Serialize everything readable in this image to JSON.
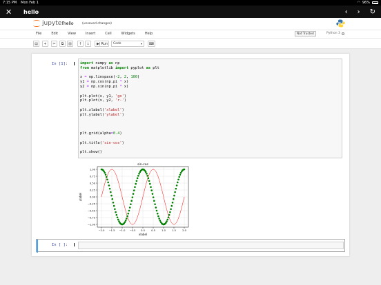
{
  "status_bar": {
    "time": "7:15 PM",
    "date": "Mon Feb 1",
    "battery": "96%"
  },
  "nav": {
    "title": "hello",
    "close_icon": "close-icon",
    "back_icon": "chevron-left-icon",
    "forward_icon": "chevron-right-icon",
    "reload_icon": "reload-icon"
  },
  "header": {
    "logo_text": "jupyter",
    "notebook_name": "hello",
    "save_status": "(unsaved changes)"
  },
  "menu": [
    "File",
    "Edit",
    "View",
    "Insert",
    "Cell",
    "Widgets",
    "Help"
  ],
  "trust_label": "Not Trusted",
  "kernel_name": "Python 3",
  "toolbar": {
    "run_label": "Run",
    "cell_type": "Code"
  },
  "cells": [
    {
      "prompt": "In [1]:",
      "code_lines": [
        "import numpy as np",
        "from matplotlib import pyplot as plt",
        "",
        "x = np.linspace(-2, 2, 100)",
        "y1 = np.cos(np.pi * x)",
        "y2 = np.sin(np.pi * x)",
        "",
        "plt.plot(x, y1, 'go')",
        "plt.plot(x, y2, 'r-')",
        "",
        "plt.xlabel('xlabel')",
        "plt.ylabel('ylabel')",
        "",
        "",
        "",
        "plt.grid(alpha=0.4)",
        "",
        "plt.title('sin-cos')",
        "",
        "plt.show()"
      ]
    },
    {
      "prompt": "In [ ]:"
    }
  ],
  "chart_data": {
    "type": "line",
    "title": "sin-cos",
    "xlabel": "xlabel",
    "ylabel": "ylabel",
    "xlim": [
      -2.2,
      2.2
    ],
    "ylim": [
      -1.1,
      1.1
    ],
    "xticks": [
      "−2.0",
      "−1.5",
      "−1.0",
      "−0.5",
      "0.0",
      "0.5",
      "1.0",
      "1.5",
      "2.0"
    ],
    "yticks": [
      "1.00",
      "0.75",
      "0.50",
      "0.25",
      "0.00",
      "−0.25",
      "−0.50",
      "−0.75",
      "−1.00"
    ],
    "grid": true,
    "series": [
      {
        "function": "cos(pi*x)",
        "style": "markers",
        "color": "#008000",
        "x_range": [
          -2,
          2
        ],
        "points": 100
      },
      {
        "function": "sin(pi*x)",
        "style": "line",
        "color": "#ff0000",
        "x_range": [
          -2,
          2
        ],
        "points": 100
      }
    ]
  },
  "colors": {
    "accent": "#42a5f5",
    "prompt": "#303f9f",
    "logo": "#f37726"
  }
}
